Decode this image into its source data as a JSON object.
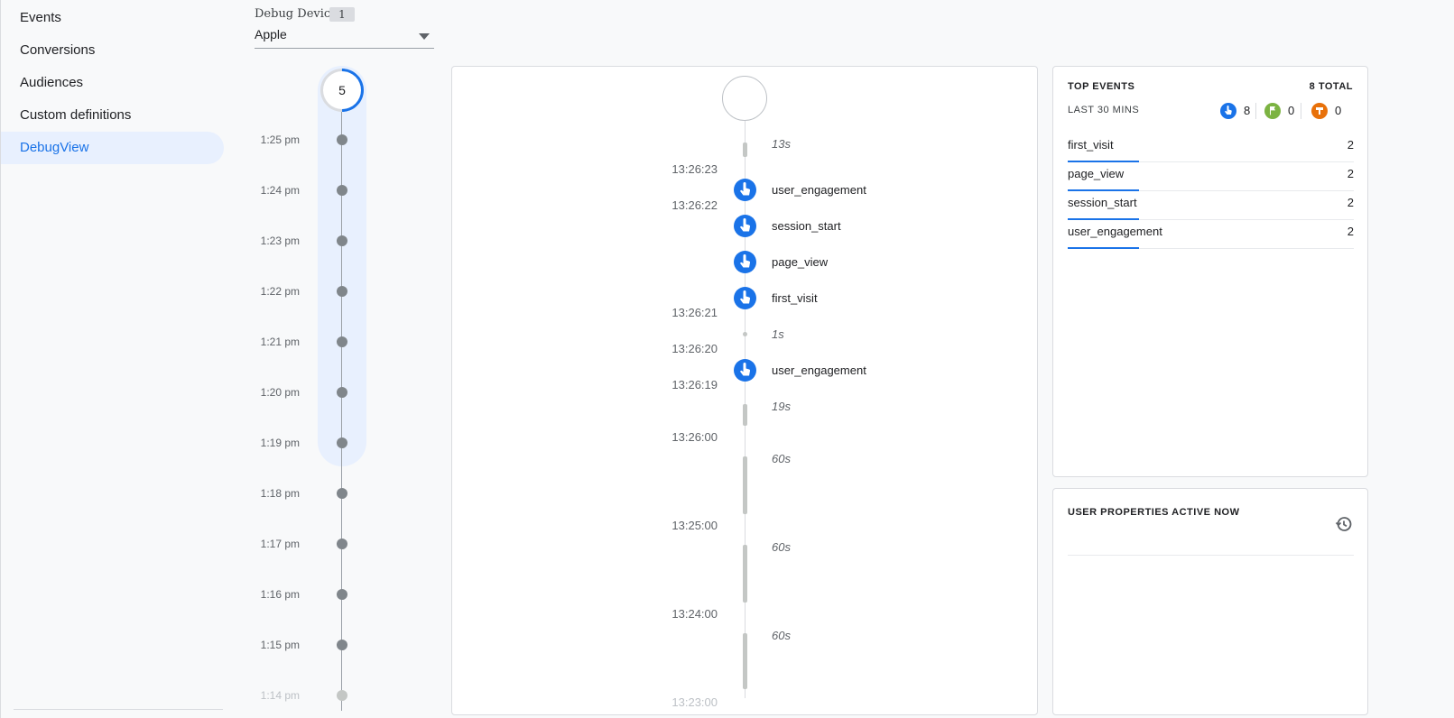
{
  "sidebar": {
    "items": [
      {
        "label": "Events"
      },
      {
        "label": "Conversions"
      },
      {
        "label": "Audiences"
      },
      {
        "label": "Custom definitions"
      },
      {
        "label": "DebugView",
        "active": true
      }
    ]
  },
  "device": {
    "label": "Debug Device",
    "count": "1",
    "selected": "Apple"
  },
  "minutes": {
    "active_count": "5",
    "times": [
      "1:25 pm",
      "1:24 pm",
      "1:23 pm",
      "1:22 pm",
      "1:21 pm",
      "1:20 pm",
      "1:19 pm",
      "1:18 pm",
      "1:17 pm",
      "1:16 pm",
      "1:15 pm",
      "1:14 pm"
    ]
  },
  "seconds_stream": {
    "gaps": [
      "13s",
      "1s",
      "19s",
      "60s",
      "60s",
      "60s"
    ],
    "timestamps": [
      "13:26:23",
      "13:26:22",
      "13:26:21",
      "13:26:20",
      "13:26:19",
      "13:26:00",
      "13:25:00",
      "13:24:00",
      "13:23:00"
    ],
    "events": [
      "user_engagement",
      "session_start",
      "page_view",
      "first_visit",
      "user_engagement"
    ]
  },
  "top_events": {
    "title": "TOP EVENTS",
    "total": "8 TOTAL",
    "period": "LAST 30 MINS",
    "badges": [
      {
        "icon": "touch-icon",
        "count": "8",
        "color": "#1a73e8"
      },
      {
        "icon": "flag-icon",
        "count": "0",
        "color": "#7cb342"
      },
      {
        "icon": "error-icon",
        "count": "0",
        "color": "#e8710a"
      }
    ],
    "rows": [
      {
        "name": "first_visit",
        "count": "2"
      },
      {
        "name": "page_view",
        "count": "2"
      },
      {
        "name": "session_start",
        "count": "2"
      },
      {
        "name": "user_engagement",
        "count": "2"
      }
    ]
  },
  "user_properties": {
    "title": "USER PROPERTIES ACTIVE NOW",
    "history_icon": "history-icon"
  }
}
